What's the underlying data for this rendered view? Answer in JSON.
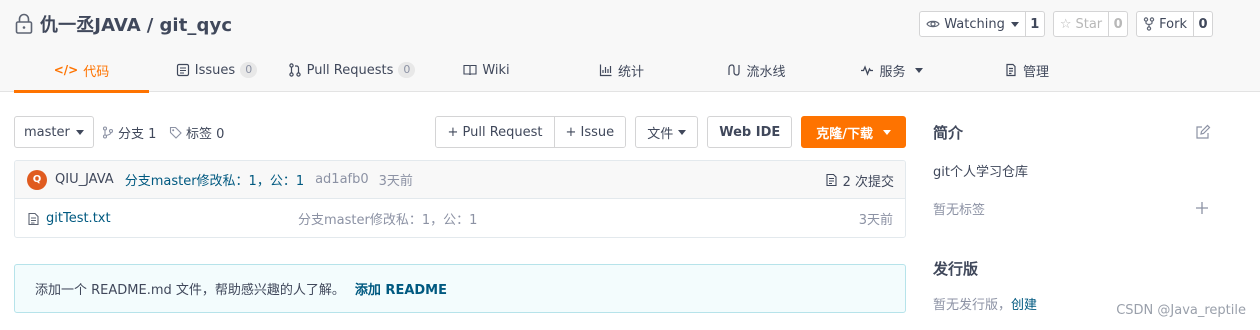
{
  "repo": {
    "owner": "仇一丞JAVA",
    "separator": "/",
    "name": "git_qyc"
  },
  "actions": {
    "watch_label": "Watching",
    "watch_count": "1",
    "star_label": "Star",
    "star_count": "0",
    "fork_label": "Fork",
    "fork_count": "0"
  },
  "tabs": [
    {
      "label": "代码",
      "icon": "code-icon",
      "active": true
    },
    {
      "label": "Issues",
      "icon": "issues-icon",
      "badge": "0"
    },
    {
      "label": "Pull Requests",
      "icon": "pull-request-icon",
      "badge": "0"
    },
    {
      "label": "Wiki",
      "icon": "wiki-icon"
    },
    {
      "label": "统计",
      "icon": "stats-icon"
    },
    {
      "label": "流水线",
      "icon": "pipeline-icon"
    },
    {
      "label": "服务",
      "icon": "service-icon"
    },
    {
      "label": "管理",
      "icon": "manage-icon"
    }
  ],
  "toolbar": {
    "branch": "master",
    "branches_label": "分支 1",
    "tags_label": "标签 0",
    "pull_request_label": "+ Pull Request",
    "issue_label": "+ Issue",
    "file_label": "文件",
    "web_ide_label": "Web IDE",
    "clone_label": "克隆/下载"
  },
  "latest_commit": {
    "avatar_letter": "Q",
    "author": "QIU_JAVA",
    "message": "分支master修改私：1，公：1",
    "sha": "ad1afb0",
    "time": "3天前",
    "commit_count_label": "2 次提交"
  },
  "files": [
    {
      "name": "gitTest.txt",
      "commit_message": "分支master修改私：1，公：1",
      "time": "3天前"
    }
  ],
  "readme_notice": {
    "text": "添加一个 README.md 文件，帮助感兴趣的人了解。",
    "link": "添加 README"
  },
  "sidebar": {
    "intro_title": "简介",
    "description": "git个人学习仓库",
    "no_tags": "暂无标签",
    "release_title": "发行版",
    "no_release": "暂无发行版，",
    "create_link": "创建"
  },
  "watermark": "CSDN @Java_reptile",
  "colors": {
    "accent": "#fe7300",
    "link": "#005980",
    "text": "#40485b",
    "muted": "#8c92a4"
  }
}
